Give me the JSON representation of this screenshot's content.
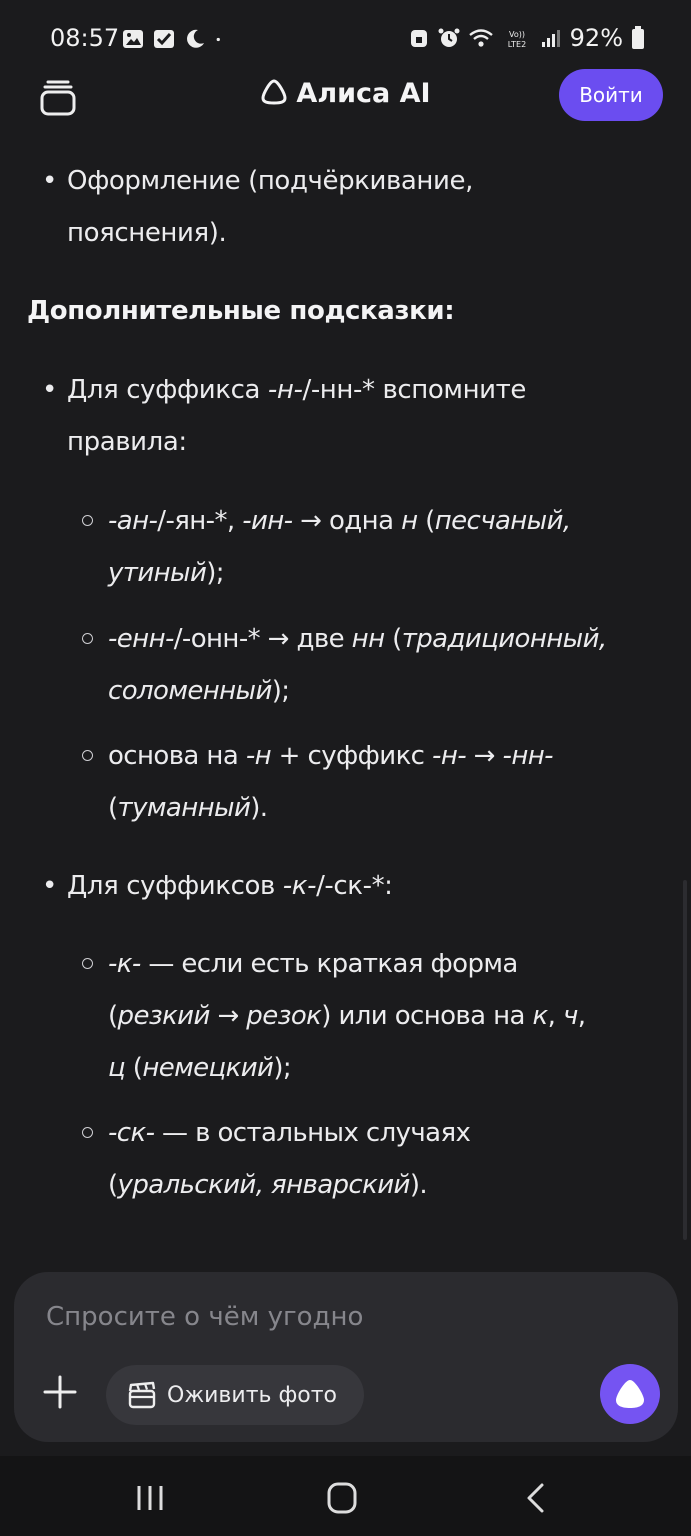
{
  "status_bar": {
    "time": "08:57",
    "battery": "92%",
    "left_icons": [
      "gallery-icon",
      "checkbox-icon",
      "moon-icon",
      "dot-icon"
    ],
    "right_icons": [
      "lock-icon",
      "alarm-icon",
      "wifi-icon",
      "volte-icon",
      "signal-icon",
      "battery-icon"
    ],
    "volte_label": "Vo)) LTE2"
  },
  "header": {
    "title": "Алиса AI",
    "login_label": "Войти",
    "accent_color": "#6b4df0"
  },
  "content": {
    "bullet_1": {
      "line_1": "Оформление (подчёркивание,",
      "line_2": "пояснения)."
    },
    "heading": "Дополнительные подсказки:",
    "bullet_2": {
      "line_1_pre": "Для суффикса ",
      "line_1_em": "-н-",
      "line_1_post": "/-нн-* вспомните",
      "line_2": "правила:"
    },
    "sub_1": {
      "a_em": "-ан-",
      "a": "/-ян-*, ",
      "b_em": "-ин-",
      "c": " → одна ",
      "d_em": "н",
      "e": " (",
      "f_em": "песчаный,",
      "line_2_em": "утиный",
      "line_2": ");"
    },
    "sub_2": {
      "a_em": "-енн-",
      "a": "/-онн-* → две ",
      "b_em": "нн",
      "c": " (",
      "d_em": "традиционный,",
      "line_2_em": "соломенный",
      "line_2": ");"
    },
    "sub_3": {
      "a": "основа на ",
      "b_em": "-н",
      "c": " + суффикс ",
      "d_em": "-н-",
      "e": " → ",
      "f_em": "-нн-",
      "line_2_pre": "(",
      "line_2_em": "туманный",
      "line_2": ")."
    },
    "bullet_3": {
      "pre": "Для суффиксов ",
      "em": "-к-",
      "post": "/-ск-*:"
    },
    "sub_4": {
      "a_em": "-к-",
      "a": " — если есть краткая форма",
      "line_2_pre": "(",
      "line_2_em1": "резкий",
      "line_2_arrow": " → ",
      "line_2_em2": "резок",
      "line_2_mid": ") или основа на ",
      "line_2_em3": "к",
      "line_2_comma": ", ",
      "line_2_em4": "ч",
      "line_2_end": ",",
      "line_3_em": "ц",
      "line_3_pre": " (",
      "line_3_em2": "немецкий",
      "line_3": ");"
    },
    "sub_5": {
      "a_em": "-ск-",
      "a": " — в остальных случаях",
      "line_2_pre": "(",
      "line_2_em": "уральский, январский",
      "line_2": ")."
    }
  },
  "composer": {
    "placeholder": "Спросите о чём угодно",
    "chip_label": "Оживить фото"
  },
  "nav_bar": {
    "buttons": [
      "recents-icon",
      "home-icon",
      "back-icon"
    ]
  }
}
